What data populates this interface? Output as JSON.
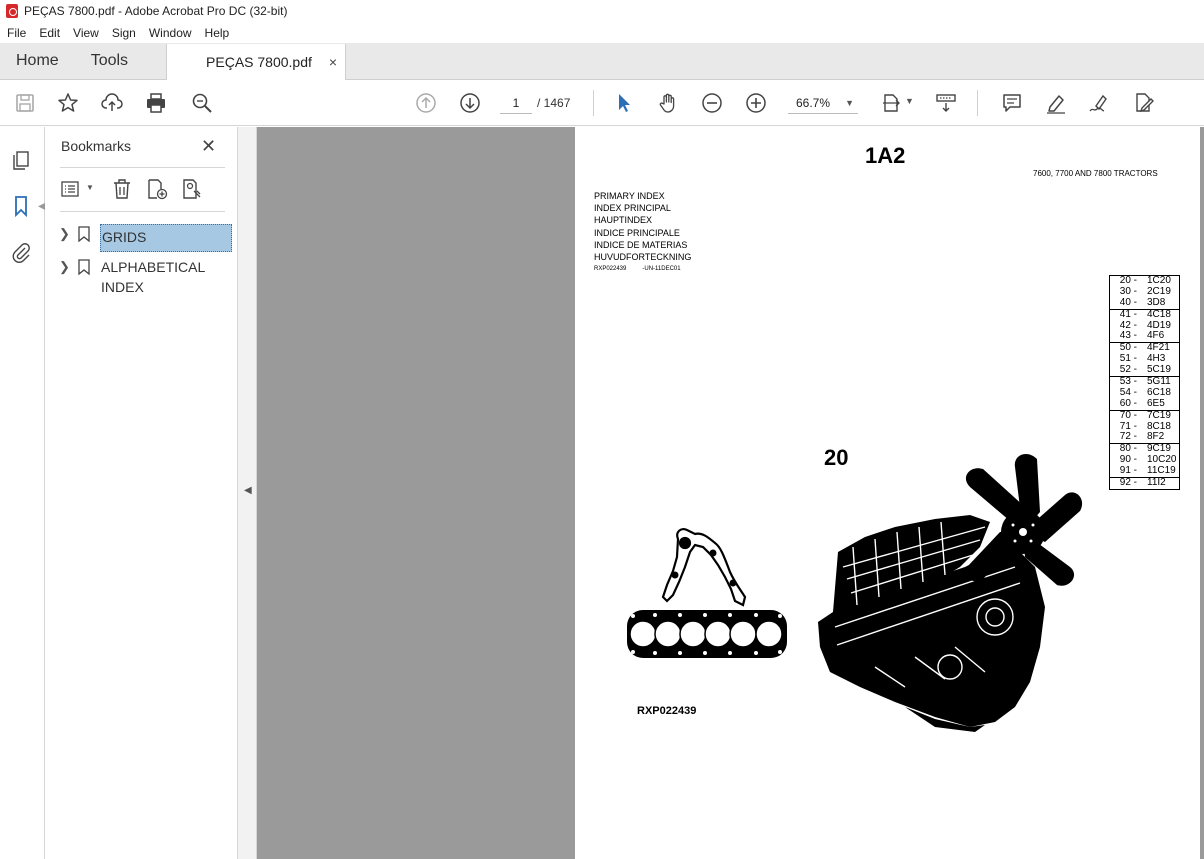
{
  "window": {
    "title": "PEÇAS 7800.pdf - Adobe Acrobat Pro DC (32-bit)"
  },
  "menu": [
    "File",
    "Edit",
    "View",
    "Sign",
    "Window",
    "Help"
  ],
  "tabs": {
    "home": "Home",
    "tools": "Tools",
    "document": "PEÇAS 7800.pdf",
    "close": "×"
  },
  "toolbar": {
    "current_page": "1",
    "total_pages": "/ 1467",
    "zoom": "66.7%"
  },
  "bookmarks": {
    "title": "Bookmarks",
    "close": "✕",
    "items": [
      {
        "label": "GRIDS",
        "selected": true
      },
      {
        "label": "ALPHABETICAL INDEX",
        "selected": false
      }
    ]
  },
  "document_page": {
    "title": "1A2",
    "subtitle": "7600, 7700 AND 7800 TRACTORS",
    "index_labels": [
      "PRIMARY INDEX",
      "INDEX PRINCIPAL",
      "HAUPTINDEX",
      "INDICE PRINCIPALE",
      "INDICE DE MATERIAS",
      "HUVUDFORTECKNING"
    ],
    "ref_code": "RXP022439",
    "ref_date": "-UN-11DEC01",
    "index_table": [
      [
        [
          "20 -",
          "1C20"
        ],
        [
          "30 -",
          "2C19"
        ],
        [
          "40 -",
          "3D8"
        ]
      ],
      [
        [
          "41 -",
          "4C18"
        ],
        [
          "42 -",
          "4D19"
        ],
        [
          "43 -",
          "4F6"
        ]
      ],
      [
        [
          "50 -",
          "4F21"
        ],
        [
          "51 -",
          "4H3"
        ],
        [
          "52 -",
          "5C19"
        ]
      ],
      [
        [
          "53 -",
          "5G11"
        ],
        [
          "54 -",
          "6C18"
        ],
        [
          "60 -",
          "6E5"
        ]
      ],
      [
        [
          "70 -",
          "7C19"
        ],
        [
          "71 -",
          "8C18"
        ],
        [
          "72 -",
          "8F2"
        ]
      ],
      [
        [
          "80 -",
          "9C19"
        ],
        [
          "90 -",
          "10C20"
        ],
        [
          "91 -",
          "11C19"
        ]
      ],
      [
        [
          "92 -",
          "11I2"
        ]
      ]
    ],
    "section_number": "20",
    "illustration_label": "RXP022439"
  },
  "colors": {
    "accent": "#2c6fb7",
    "selection": "#a6c8e3",
    "canvas": "#9a9a9a",
    "acrobat_red": "#d62828"
  },
  "icons": [
    "save-icon",
    "star-icon",
    "upload-icon",
    "print-icon",
    "zoom-search-icon",
    "prev-page-icon",
    "next-page-icon",
    "select-cursor-icon",
    "hand-icon",
    "zoom-out-icon",
    "zoom-in-icon",
    "fit-page-icon",
    "scroll-mode-icon",
    "comment-icon",
    "highlight-icon",
    "sign-icon",
    "edit-pdf-icon"
  ]
}
